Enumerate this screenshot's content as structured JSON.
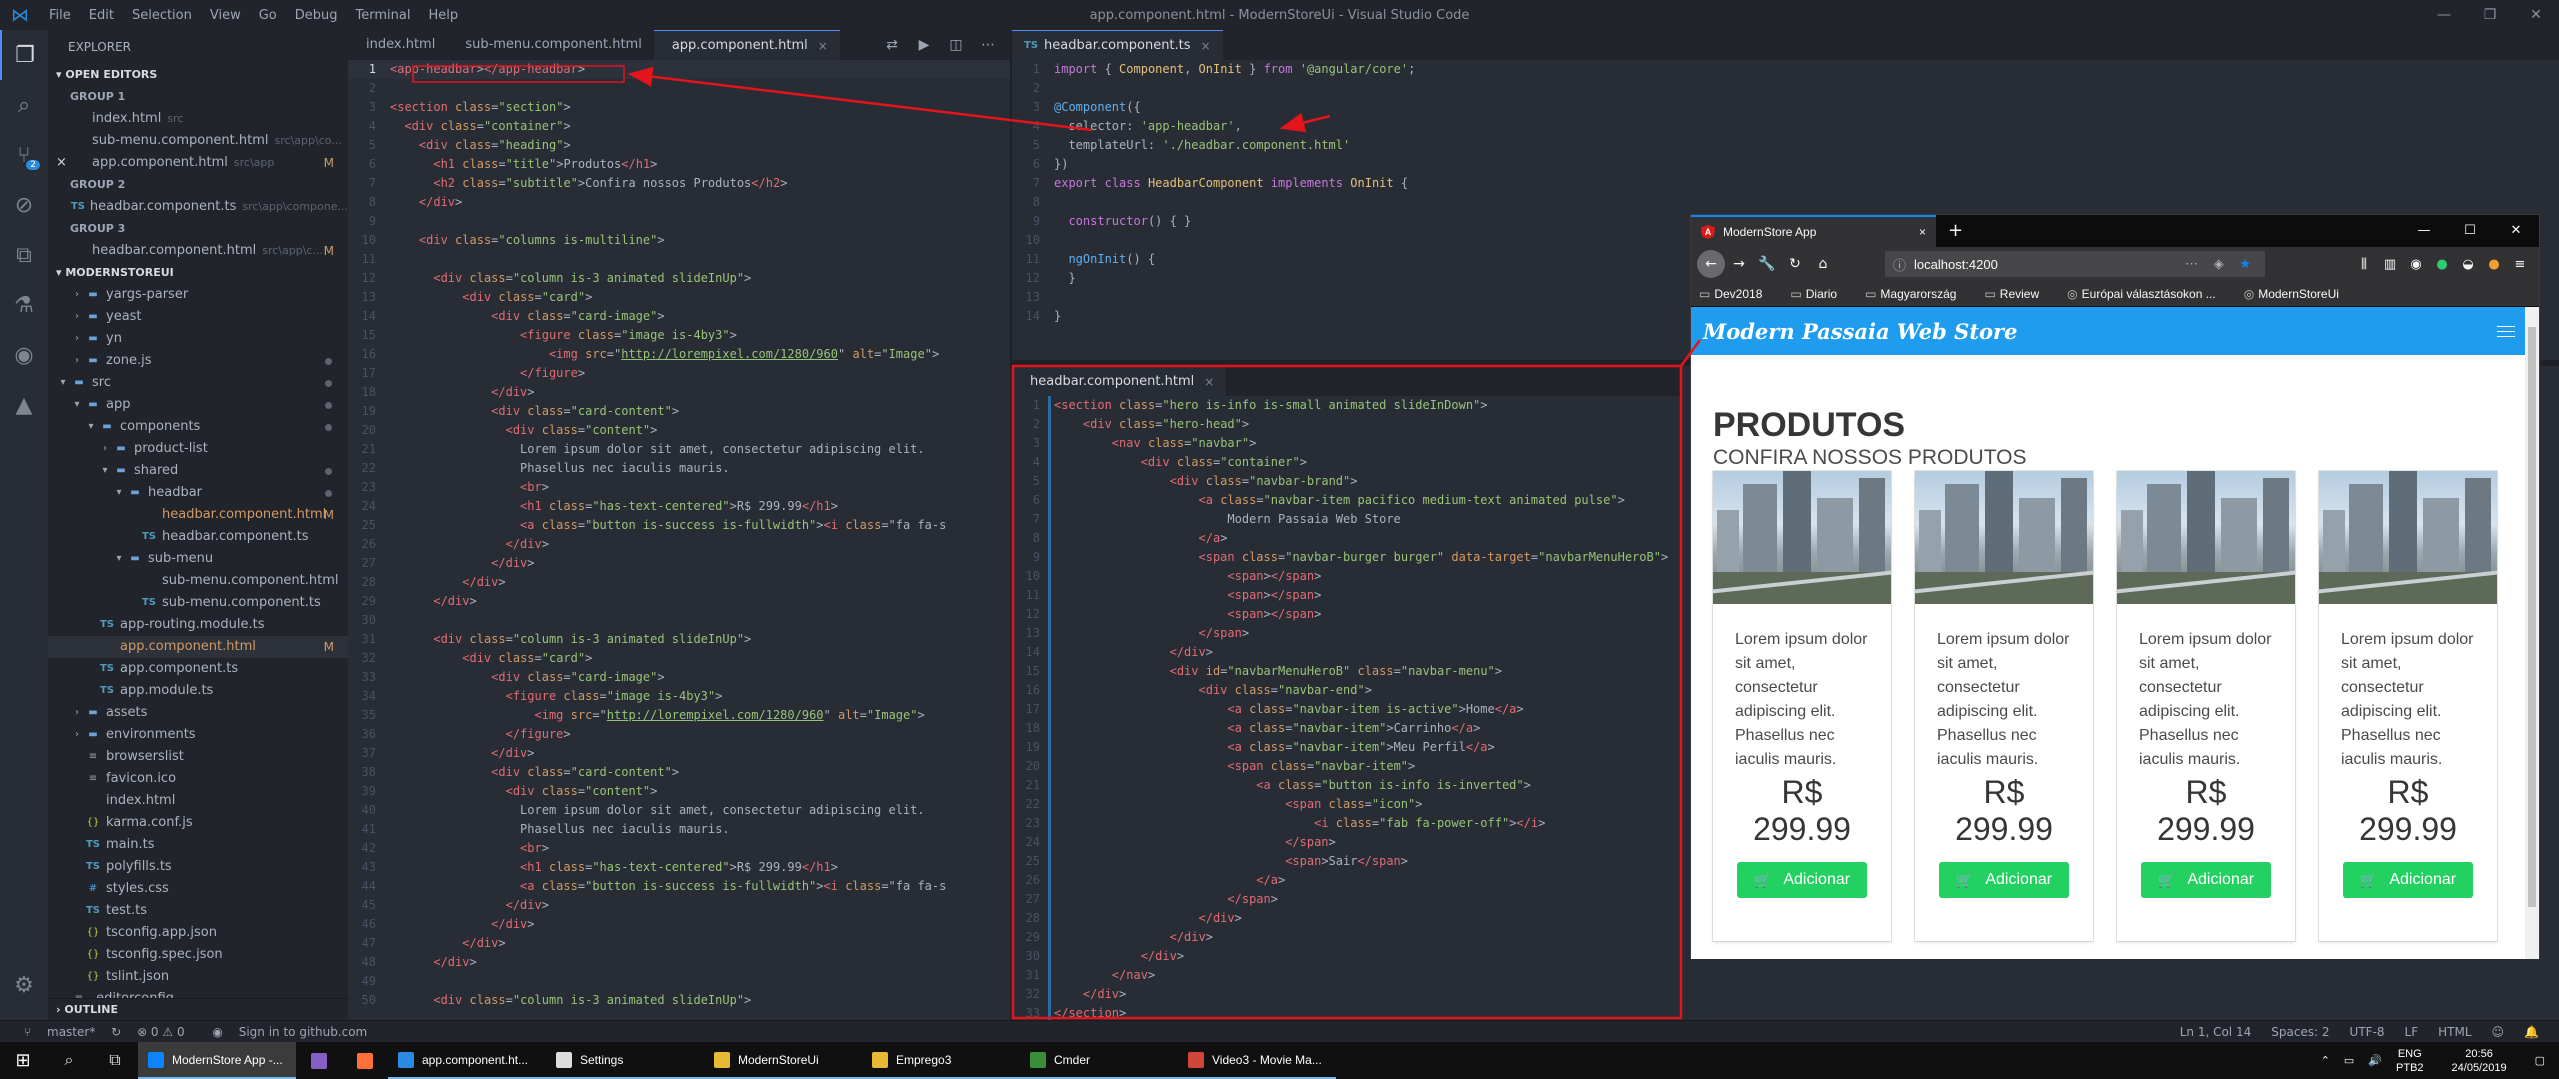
{
  "window": {
    "title": "app.component.html - ModernStoreUi - Visual Studio Code",
    "menu": [
      "File",
      "Edit",
      "Selection",
      "View",
      "Go",
      "Debug",
      "Terminal",
      "Help"
    ]
  },
  "explorer": {
    "title": "EXPLORER",
    "open_editors_label": "OPEN EDITORS",
    "groups": [
      {
        "label": "GROUP 1",
        "files": [
          {
            "name": "index.html",
            "path": "src",
            "icon": "html"
          },
          {
            "name": "sub-menu.component.html",
            "path": "src\\app\\co...",
            "icon": "html"
          },
          {
            "name": "app.component.html",
            "path": "src\\app",
            "icon": "html",
            "modified": "M",
            "close": "×"
          }
        ]
      },
      {
        "label": "GROUP 2",
        "files": [
          {
            "name": "headbar.component.ts",
            "path": "src\\app\\compone...",
            "icon": "ts"
          }
        ]
      },
      {
        "label": "GROUP 3",
        "files": [
          {
            "name": "headbar.component.html",
            "path": "src\\app\\c...",
            "icon": "html",
            "modified": "M"
          }
        ]
      }
    ],
    "project_label": "MODERNSTOREUI",
    "tree": [
      {
        "name": "yargs-parser",
        "icon": "folder",
        "depth": 1
      },
      {
        "name": "yeast",
        "icon": "folder",
        "depth": 1
      },
      {
        "name": "yn",
        "icon": "folder",
        "depth": 1
      },
      {
        "name": "zone.js",
        "icon": "folder",
        "depth": 1,
        "dot": true
      },
      {
        "name": "src",
        "icon": "folder",
        "depth": 0,
        "open": true,
        "dot": true
      },
      {
        "name": "app",
        "icon": "folder",
        "depth": 1,
        "open": true,
        "dot": true
      },
      {
        "name": "components",
        "icon": "folder",
        "depth": 2,
        "open": true,
        "dot": true
      },
      {
        "name": "product-list",
        "icon": "folder",
        "depth": 3
      },
      {
        "name": "shared",
        "icon": "folder",
        "depth": 3,
        "open": true,
        "dot": true
      },
      {
        "name": "headbar",
        "icon": "folder",
        "depth": 4,
        "open": true,
        "dot": true
      },
      {
        "name": "headbar.component.html",
        "icon": "html",
        "depth": 5,
        "modified": "M"
      },
      {
        "name": "headbar.component.ts",
        "icon": "ts",
        "depth": 5
      },
      {
        "name": "sub-menu",
        "icon": "folder",
        "depth": 4,
        "open": true
      },
      {
        "name": "sub-menu.component.html",
        "icon": "html",
        "depth": 5
      },
      {
        "name": "sub-menu.component.ts",
        "icon": "ts",
        "depth": 5
      },
      {
        "name": "app-routing.module.ts",
        "icon": "ts",
        "depth": 2
      },
      {
        "name": "app.component.html",
        "icon": "html",
        "depth": 2,
        "modified": "M",
        "selected": true
      },
      {
        "name": "app.component.ts",
        "icon": "ts",
        "depth": 2
      },
      {
        "name": "app.module.ts",
        "icon": "ts",
        "depth": 2
      },
      {
        "name": "assets",
        "icon": "folder",
        "depth": 1
      },
      {
        "name": "environments",
        "icon": "folder",
        "depth": 1
      },
      {
        "name": "browserslist",
        "icon": "file",
        "depth": 1
      },
      {
        "name": "favicon.ico",
        "icon": "file",
        "depth": 1
      },
      {
        "name": "index.html",
        "icon": "html",
        "depth": 1
      },
      {
        "name": "karma.conf.js",
        "icon": "json",
        "depth": 1
      },
      {
        "name": "main.ts",
        "icon": "ts",
        "depth": 1
      },
      {
        "name": "polyfills.ts",
        "icon": "ts",
        "depth": 1
      },
      {
        "name": "styles.css",
        "icon": "css",
        "depth": 1
      },
      {
        "name": "test.ts",
        "icon": "ts",
        "depth": 1
      },
      {
        "name": "tsconfig.app.json",
        "icon": "json",
        "depth": 1
      },
      {
        "name": "tsconfig.spec.json",
        "icon": "json",
        "depth": 1
      },
      {
        "name": "tslint.json",
        "icon": "json",
        "depth": 1
      },
      {
        "name": ".editorconfig",
        "icon": "file",
        "depth": 0
      }
    ],
    "outline_label": "OUTLINE"
  },
  "editor1": {
    "tabs": [
      {
        "label": "index.html",
        "icon": "html",
        "active": false
      },
      {
        "label": "sub-menu.component.html",
        "icon": "html",
        "active": false
      },
      {
        "label": "app.component.html",
        "icon": "html",
        "active": true,
        "close": "×"
      }
    ],
    "current_line": 1,
    "lines": [
      "<app-headbar></app-headbar>",
      "",
      "<section class=\"section\">",
      "  <div class=\"container\">",
      "    <div class=\"heading\">",
      "      <h1 class=\"title\">Produtos</h1>",
      "      <h2 class=\"subtitle\">Confira nossos Produtos</h2>",
      "    </div>",
      "",
      "    <div class=\"columns is-multiline\">",
      "",
      "      <div class=\"column is-3 animated slideInUp\">",
      "          <div class=\"card\">",
      "              <div class=\"card-image\">",
      "                  <figure class=\"image is-4by3\">",
      "                      <img src=\"http://lorempixel.com/1280/960\" alt=\"Image\">",
      "                  </figure>",
      "              </div>",
      "              <div class=\"card-content\">",
      "                <div class=\"content\">",
      "                  Lorem ipsum dolor sit amet, consectetur adipiscing elit.",
      "                  Phasellus nec iaculis mauris.",
      "                  <br>",
      "                  <h1 class=\"has-text-centered\">R$ 299.99</h1>",
      "                  <a class=\"button is-success is-fullwidth\"><i class=\"fa fa-s",
      "                </div>",
      "              </div>",
      "          </div>",
      "      </div>",
      "",
      "      <div class=\"column is-3 animated slideInUp\">",
      "          <div class=\"card\">",
      "              <div class=\"card-image\">",
      "                <figure class=\"image is-4by3\">",
      "                    <img src=\"http://lorempixel.com/1280/960\" alt=\"Image\">",
      "                </figure>",
      "              </div>",
      "              <div class=\"card-content\">",
      "                <div class=\"content\">",
      "                  Lorem ipsum dolor sit amet, consectetur adipiscing elit.",
      "                  Phasellus nec iaculis mauris.",
      "                  <br>",
      "                  <h1 class=\"has-text-centered\">R$ 299.99</h1>",
      "                  <a class=\"button is-success is-fullwidth\"><i class=\"fa fa-s",
      "                </div>",
      "              </div>",
      "          </div>",
      "      </div>",
      "",
      "      <div class=\"column is-3 animated slideInUp\">"
    ]
  },
  "editor2": {
    "tabs": [
      {
        "label": "headbar.component.ts",
        "icon": "ts",
        "active": true,
        "close": "×"
      }
    ],
    "lines": [
      "import { Component, OnInit } from '@angular/core';",
      "",
      "@Component({",
      "  selector: 'app-headbar',",
      "  templateUrl: './headbar.component.html'",
      "})",
      "export class HeadbarComponent implements OnInit {",
      "",
      "  constructor() { }",
      "",
      "  ngOnInit() {",
      "  }",
      "",
      "}"
    ]
  },
  "editor3": {
    "tabs": [
      {
        "label": "headbar.component.html",
        "icon": "html",
        "active": true,
        "close": "×"
      }
    ],
    "lines": [
      "<section class=\"hero is-info is-small animated slideInDown\">",
      "    <div class=\"hero-head\">",
      "        <nav class=\"navbar\">",
      "            <div class=\"container\">",
      "                <div class=\"navbar-brand\">",
      "                    <a class=\"navbar-item pacifico medium-text animated pulse\">",
      "                        Modern Passaia Web Store",
      "                    </a>",
      "                    <span class=\"navbar-burger burger\" data-target=\"navbarMenuHeroB\">",
      "                        <span></span>",
      "                        <span></span>",
      "                        <span></span>",
      "                    </span>",
      "                </div>",
      "                <div id=\"navbarMenuHeroB\" class=\"navbar-menu\">",
      "                    <div class=\"navbar-end\">",
      "                        <a class=\"navbar-item is-active\">Home</a>",
      "                        <a class=\"navbar-item\">Carrinho</a>",
      "                        <a class=\"navbar-item\">Meu Perfil</a>",
      "                        <span class=\"navbar-item\">",
      "                            <a class=\"button is-info is-inverted\">",
      "                                <span class=\"icon\">",
      "                                    <i class=\"fab fa-power-off\"></i>",
      "                                </span>",
      "                                <span>Sair</span>",
      "                            </a>",
      "                        </span>",
      "                    </div>",
      "                </div>",
      "            </div>",
      "        </nav>",
      "    </div>",
      "</section>"
    ]
  },
  "browser": {
    "tab_title": "ModernStore App",
    "tab_close": "×",
    "new_tab": "+",
    "url": "localhost:4200",
    "bookmarks": [
      "Dev2018",
      "Diario",
      "Magyarország",
      "Review",
      "Európai választásokon ...",
      "ModernStoreUi"
    ],
    "page": {
      "brand": "Modern Passaia Web Store",
      "title": "PRODUTOS",
      "subtitle": "CONFIRA NOSSOS PRODUTOS",
      "products": [
        {
          "text": "Lorem ipsum dolor sit amet, consectetur adipiscing elit. Phasellus nec iaculis mauris.",
          "price_currency": "R$",
          "price": "299.99",
          "button": "Adicionar"
        },
        {
          "text": "Lorem ipsum dolor sit amet, consectetur adipiscing elit. Phasellus nec iaculis mauris.",
          "price_currency": "R$",
          "price": "299.99",
          "button": "Adicionar"
        },
        {
          "text": "Lorem ipsum dolor sit amet, consectetur adipiscing elit. Phasellus nec iaculis mauris.",
          "price_currency": "R$",
          "price": "299.99",
          "button": "Adicionar"
        },
        {
          "text": "Lorem ipsum dolor sit amet, consectetur adipiscing elit. Phasellus nec iaculis mauris.",
          "price_currency": "R$",
          "price": "299.99",
          "button": "Adicionar"
        }
      ]
    }
  },
  "statusbar": {
    "branch": "master*",
    "sync": "↻",
    "problems": "⊗ 0 ⚠ 0",
    "signin": "Sign in to github.com",
    "position": "Ln 1, Col 14",
    "spaces": "Spaces: 2",
    "encoding": "UTF-8",
    "eol": "LF",
    "language": "HTML"
  },
  "taskbar": {
    "apps": [
      {
        "label": "ModernStore App -...",
        "color": "#0a84ff",
        "active": true
      },
      {
        "label": "",
        "color": "#865fc5",
        "active": false,
        "icon_only": true
      },
      {
        "label": "",
        "color": "#ff7139",
        "active": false,
        "icon_only": true
      },
      {
        "label": "app.component.ht...",
        "color": "#2b8be0",
        "active": false
      },
      {
        "label": "Settings",
        "color": "#dddddd",
        "active": false
      },
      {
        "label": "ModernStoreUi",
        "color": "#e8b933",
        "active": false
      },
      {
        "label": "Emprego3",
        "color": "#e8b933",
        "active": false
      },
      {
        "label": "Cmder",
        "color": "#3a8e3a",
        "active": false
      },
      {
        "label": "Video3 - Movie Ma...",
        "color": "#d0453a",
        "active": false
      }
    ],
    "lang": "ENG",
    "layout": "PTB2",
    "time": "20:56",
    "date": "24/05/2019"
  },
  "colors": {
    "accent": "#528bff",
    "hero": "#209cee",
    "success": "#23d160",
    "annotation": "#e3141b"
  }
}
